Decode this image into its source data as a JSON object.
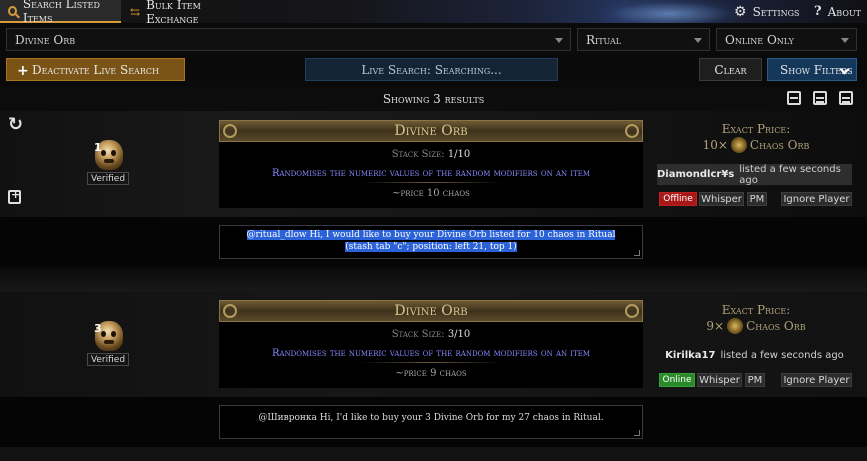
{
  "nav": {
    "search_tab": "Search Listed Items",
    "bulk_tab": "Bulk Item Exchange",
    "settings": "Settings",
    "about": "About"
  },
  "search": {
    "item_value": "Divine Orb",
    "league_value": "Ritual",
    "online_value": "Online Only"
  },
  "actions": {
    "deactivate_label": "Deactivate Live Search",
    "live_status": "Live Search: Searching...",
    "clear_label": "Clear",
    "filters_label": "Show Filters"
  },
  "results": {
    "count_text": "Showing 3 results"
  },
  "listings": [
    {
      "quantity": "1",
      "verified": "Verified",
      "item_name": "Divine Orb",
      "stack_label": "Stack Size:",
      "stack_value": "1/10",
      "description": "Randomises the numeric values of the random modifiers on an item",
      "price_note": "~price 10 chaos",
      "exact_label": "Exact Price:",
      "price_amount": "10×",
      "price_currency": "Chaos Orb",
      "seller": "Diamondlcr¥s",
      "listed": "listed a few seconds ago",
      "status": "Offline",
      "whisper": "Whisper",
      "pm": "PM",
      "ignore": "Ignore Player",
      "whisper_msg": "@ritual_dlow Hi, I would like to buy your Divine Orb listed for 10 chaos in Ritual (stash tab \"c\"; position: left 21, top 1)"
    },
    {
      "quantity": "3",
      "verified": "Verified",
      "item_name": "Divine Orb",
      "stack_label": "Stack Size:",
      "stack_value": "3/10",
      "description": "Randomises the numeric values of the random modifiers on an item",
      "price_note": "~price 9 chaos",
      "exact_label": "Exact Price:",
      "price_amount": "9×",
      "price_currency": "Chaos Orb",
      "seller": "Kirilka17",
      "listed": "listed a few seconds ago",
      "status": "Online",
      "whisper": "Whisper",
      "pm": "PM",
      "ignore": "Ignore Player",
      "whisper_msg": "@Шиврoнка Hi, I'd like to buy your 3 Divine Orb for my 27 chaos in Ritual."
    }
  ],
  "icons": {
    "search": "magnifier-icon",
    "bulk": "swap-icon",
    "settings": "gear-icon",
    "about": "question-icon",
    "refresh": "refresh-icon",
    "copy": "copy-add-icon",
    "currency": "chaos-orb-icon",
    "item": "divine-orb-icon"
  },
  "colors": {
    "accent_gold": "#d89b3a",
    "offline": "#a81818",
    "online": "#2a8a2a",
    "filters_blue": "#14375a",
    "mod_text": "#8888ff"
  }
}
